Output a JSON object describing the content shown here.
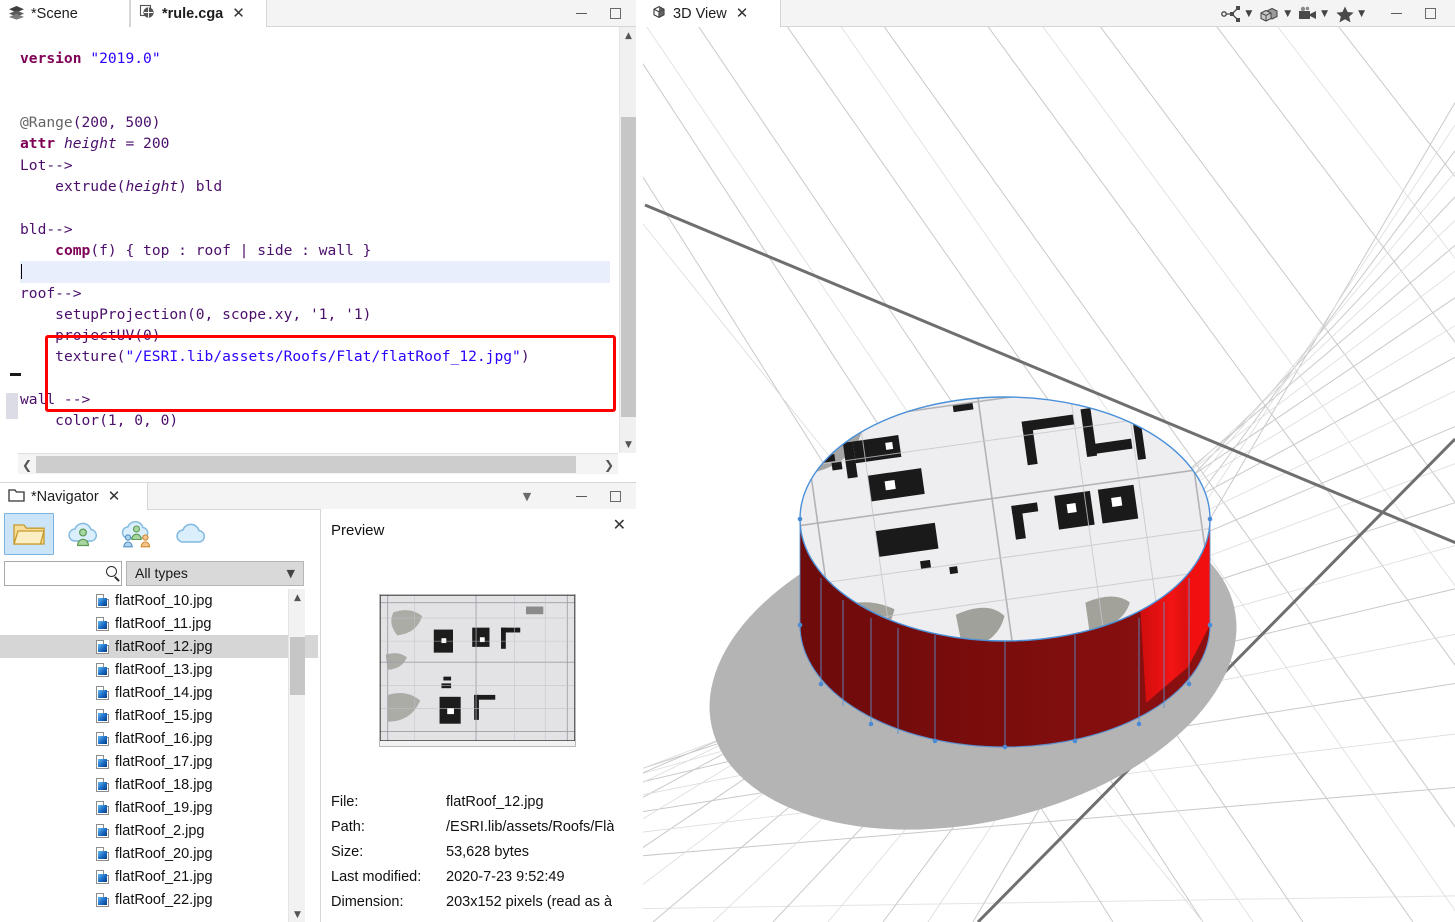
{
  "editor": {
    "tabs": [
      {
        "label": "*Scene",
        "icon": "layers-icon",
        "closable": false,
        "bold": false
      },
      {
        "label": "*rule.cga",
        "icon": "cga-rule-icon",
        "closable": true,
        "bold": true
      }
    ],
    "window_controls": [
      "minimize",
      "maximize"
    ],
    "code_lines": [
      {
        "indent": 0,
        "tokens": []
      },
      {
        "indent": 0,
        "tokens": [
          {
            "t": "version",
            "c": "k"
          },
          {
            "t": " ",
            "c": "p"
          },
          {
            "t": "\"2019.0\"",
            "c": "st"
          }
        ]
      },
      {
        "indent": 0,
        "tokens": []
      },
      {
        "indent": 0,
        "tokens": []
      },
      {
        "indent": 0,
        "tokens": [
          {
            "t": "@Range",
            "c": "an"
          },
          {
            "t": "(200, 500)",
            "c": "p"
          }
        ]
      },
      {
        "indent": 0,
        "tokens": [
          {
            "t": "attr",
            "c": "k"
          },
          {
            "t": " ",
            "c": "p"
          },
          {
            "t": "height",
            "c": "it"
          },
          {
            "t": " = 200",
            "c": "p"
          }
        ]
      },
      {
        "indent": 0,
        "tokens": [
          {
            "t": "Lot-->",
            "c": "p"
          }
        ]
      },
      {
        "indent": 1,
        "tokens": [
          {
            "t": "extrude(",
            "c": "p"
          },
          {
            "t": "height",
            "c": "it"
          },
          {
            "t": ") bld",
            "c": "p"
          }
        ]
      },
      {
        "indent": 0,
        "tokens": []
      },
      {
        "indent": 0,
        "tokens": [
          {
            "t": "bld-->",
            "c": "p"
          }
        ]
      },
      {
        "indent": 1,
        "tokens": [
          {
            "t": "comp",
            "c": "k"
          },
          {
            "t": "(f) { top : roof | side : wall }",
            "c": "p"
          }
        ]
      },
      {
        "indent": 0,
        "tokens": [],
        "highlight": true,
        "caret": true
      },
      {
        "indent": 0,
        "tokens": [
          {
            "t": "roof-->",
            "c": "p"
          }
        ]
      },
      {
        "indent": 1,
        "tokens": [
          {
            "t": "setupProjection(0, scope.xy, '1, '1)",
            "c": "p"
          }
        ]
      },
      {
        "indent": 1,
        "tokens": [
          {
            "t": "projectUV(0)",
            "c": "p"
          }
        ]
      },
      {
        "indent": 1,
        "tokens": [
          {
            "t": "texture(",
            "c": "p"
          },
          {
            "t": "\"/ESRI.lib/assets/Roofs/Flat/flatRoof_12.jpg\"",
            "c": "st"
          },
          {
            "t": ")",
            "c": "p"
          }
        ]
      },
      {
        "indent": 0,
        "tokens": []
      },
      {
        "indent": 0,
        "tokens": [
          {
            "t": "wall -->",
            "c": "p"
          }
        ]
      },
      {
        "indent": 1,
        "tokens": [
          {
            "t": "color(1, 0, 0)",
            "c": "p"
          }
        ]
      }
    ],
    "highlight_box": {
      "color": "#ff0000",
      "label": "roof-rule-highlight"
    },
    "fold_marker": "collapse-marker",
    "scroll": {
      "vertical_thumb_pct": 70,
      "horizontal_thumb_pct": 90
    }
  },
  "navigator": {
    "tab": {
      "label": "*Navigator",
      "icon": "folder-tab-icon"
    },
    "header_controls": [
      "view-menu",
      "minimize",
      "maximize"
    ],
    "toolbar": [
      {
        "name": "local-folder-icon",
        "selected": true
      },
      {
        "name": "my-content-cloud-icon",
        "selected": false
      },
      {
        "name": "shared-content-cloud-icon",
        "selected": false
      },
      {
        "name": "public-cloud-icon",
        "selected": false
      }
    ],
    "search": {
      "value": "",
      "placeholder": ""
    },
    "type_filter": {
      "selected": "All types",
      "options": [
        "All types"
      ]
    },
    "files": [
      {
        "name": "flatRoof_10.jpg",
        "selected": false
      },
      {
        "name": "flatRoof_11.jpg",
        "selected": false
      },
      {
        "name": "flatRoof_12.jpg",
        "selected": true
      },
      {
        "name": "flatRoof_13.jpg",
        "selected": false
      },
      {
        "name": "flatRoof_14.jpg",
        "selected": false
      },
      {
        "name": "flatRoof_15.jpg",
        "selected": false
      },
      {
        "name": "flatRoof_16.jpg",
        "selected": false
      },
      {
        "name": "flatRoof_17.jpg",
        "selected": false
      },
      {
        "name": "flatRoof_18.jpg",
        "selected": false
      },
      {
        "name": "flatRoof_19.jpg",
        "selected": false
      },
      {
        "name": "flatRoof_2.jpg",
        "selected": false
      },
      {
        "name": "flatRoof_20.jpg",
        "selected": false
      },
      {
        "name": "flatRoof_21.jpg",
        "selected": false
      },
      {
        "name": "flatRoof_22.jpg",
        "selected": false
      }
    ]
  },
  "preview": {
    "title": "Preview",
    "close_icon": "close-icon",
    "thumbnail": "aerial-roof-texture-thumbnail",
    "metadata": [
      {
        "key": "File:",
        "value": "flatRoof_12.jpg"
      },
      {
        "key": "Path:",
        "value": "/ESRI.lib/assets/Roofs/Flà"
      },
      {
        "key": "Size:",
        "value": "53,628 bytes"
      },
      {
        "key": "Last modified:",
        "value": "2020-7-23 9:52:49"
      },
      {
        "key": "Dimension:",
        "value": "203x152 pixels (read as à"
      }
    ]
  },
  "view3d": {
    "tab": {
      "label": "3D View",
      "icon": "cube-icon",
      "closable": true
    },
    "toolbar": [
      {
        "name": "scene-graph-icon",
        "dropdown": true
      },
      {
        "name": "model-display-icon",
        "dropdown": true
      },
      {
        "name": "camera-icon",
        "dropdown": true
      },
      {
        "name": "bookmark-star-icon",
        "dropdown": true
      }
    ],
    "window_controls": [
      "minimize",
      "maximize"
    ],
    "model": {
      "name": "extruded-cylinder-building",
      "wall_color": "#7a0c0c",
      "wall_highlight_color": "#ee0f0f",
      "roof_texture": "flatRoof_12.jpg",
      "selection_edge_color": "#4a90d9",
      "shadow_color": "#b4b4b4"
    },
    "grid": {
      "line_color": "#c8c8c8",
      "axis_color": "#6a6a6a"
    }
  }
}
